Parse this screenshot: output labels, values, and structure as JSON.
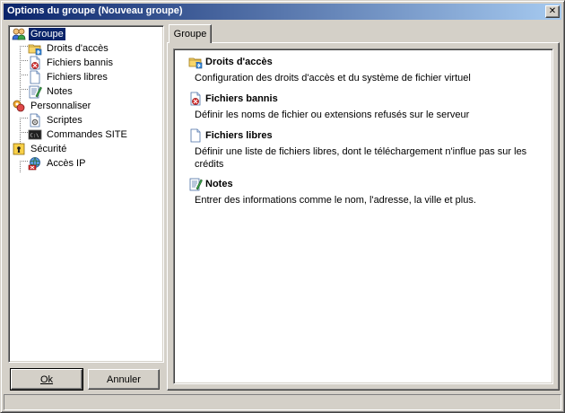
{
  "window": {
    "title": "Options du groupe (Nouveau groupe)",
    "close_symbol": "✕"
  },
  "tree": {
    "items": [
      {
        "label": "Groupe",
        "icon": "group-icon",
        "selected": true
      },
      {
        "label": "Droits d'accès",
        "icon": "folder-access-icon"
      },
      {
        "label": "Fichiers bannis",
        "icon": "banned-file-icon"
      },
      {
        "label": "Fichiers libres",
        "icon": "free-file-icon"
      },
      {
        "label": "Notes",
        "icon": "notes-icon"
      },
      {
        "label": "Personnaliser",
        "icon": "customize-icon"
      },
      {
        "label": "Scriptes",
        "icon": "script-icon"
      },
      {
        "label": "Commandes SITE",
        "icon": "console-icon"
      },
      {
        "label": "Sécurité",
        "icon": "lock-icon"
      },
      {
        "label": "Accès IP",
        "icon": "ip-access-icon"
      }
    ]
  },
  "buttons": {
    "ok_label": "Ok",
    "cancel_label": "Annuler"
  },
  "tabs": [
    {
      "label": "Groupe",
      "active": true
    }
  ],
  "panel": {
    "sections": [
      {
        "title": "Droits d'accès",
        "icon": "folder-access-icon",
        "description": "Configuration des droits d'accès et du système de fichier virtuel"
      },
      {
        "title": "Fichiers bannis",
        "icon": "banned-file-icon",
        "description": "Définir les noms de fichier ou extensions refusés sur le serveur"
      },
      {
        "title": "Fichiers libres",
        "icon": "free-file-icon",
        "description": "Définir une liste de fichiers libres, dont le téléchargement n'influe pas sur les crédits"
      },
      {
        "title": "Notes",
        "icon": "notes-icon",
        "description": "Entrer des informations comme le nom, l'adresse, la ville et plus."
      }
    ]
  },
  "colors": {
    "face": "#d4d0c8",
    "titlebar_start": "#0a246a",
    "titlebar_end": "#a6caf0",
    "selection": "#0a246a"
  }
}
